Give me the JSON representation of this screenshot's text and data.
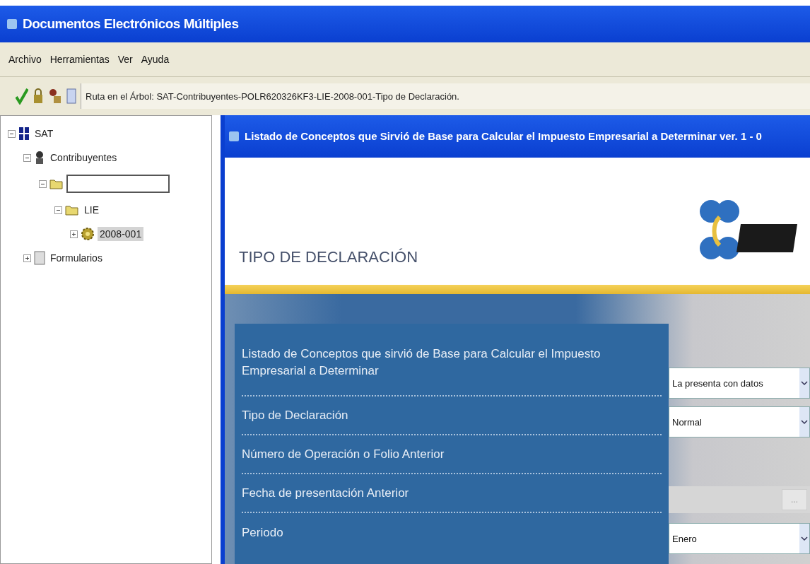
{
  "window": {
    "title": "Documentos Electrónicos Múltiples"
  },
  "menu": [
    "Archivo",
    "Herramientas",
    "Ver",
    "Ayuda"
  ],
  "toolbar": {
    "path_text": "Ruta en el Árbol: SAT-Contribuyentes-POLR620326KF3-LIE-2008-001-Tipo de Declaración."
  },
  "tree": [
    {
      "label": "SAT",
      "kind": "root",
      "expanded": true,
      "selected": false,
      "children": [
        {
          "label": "Contribuyentes",
          "kind": "person",
          "expanded": true,
          "selected": false,
          "children": [
            {
              "kind": "rename",
              "expanded": true,
              "selected": false,
              "children": [
                {
                  "label": "LIE",
                  "kind": "folder",
                  "expanded": true,
                  "selected": false,
                  "children": [
                    {
                      "label": "2008-001",
                      "kind": "gear",
                      "expanded": false,
                      "selected": true
                    }
                  ]
                }
              ]
            }
          ]
        },
        {
          "label": "Formularios",
          "kind": "forms",
          "expanded": false,
          "selected": false
        }
      ]
    }
  ],
  "panel": {
    "title": "Listado de Conceptos que Sirvió de Base para Calcular el Impuesto Empresarial a Determinar ver. 1 - 0",
    "heading": "TIPO DE DECLARACIÓN",
    "labels": [
      "Listado de Conceptos que sirvió de Base para Calcular el Impuesto Empresarial a Determinar",
      "Tipo de Declaración",
      "Número de Operación o Folio Anterior",
      "Fecha de presentación Anterior",
      "Periodo"
    ],
    "fields": [
      {
        "kind": "select",
        "value": "La presenta con datos"
      },
      {
        "kind": "select",
        "value": "Normal"
      },
      {
        "kind": "none"
      },
      {
        "kind": "date",
        "disabled": true,
        "button": "..."
      },
      {
        "kind": "select",
        "value": "Enero"
      }
    ]
  }
}
